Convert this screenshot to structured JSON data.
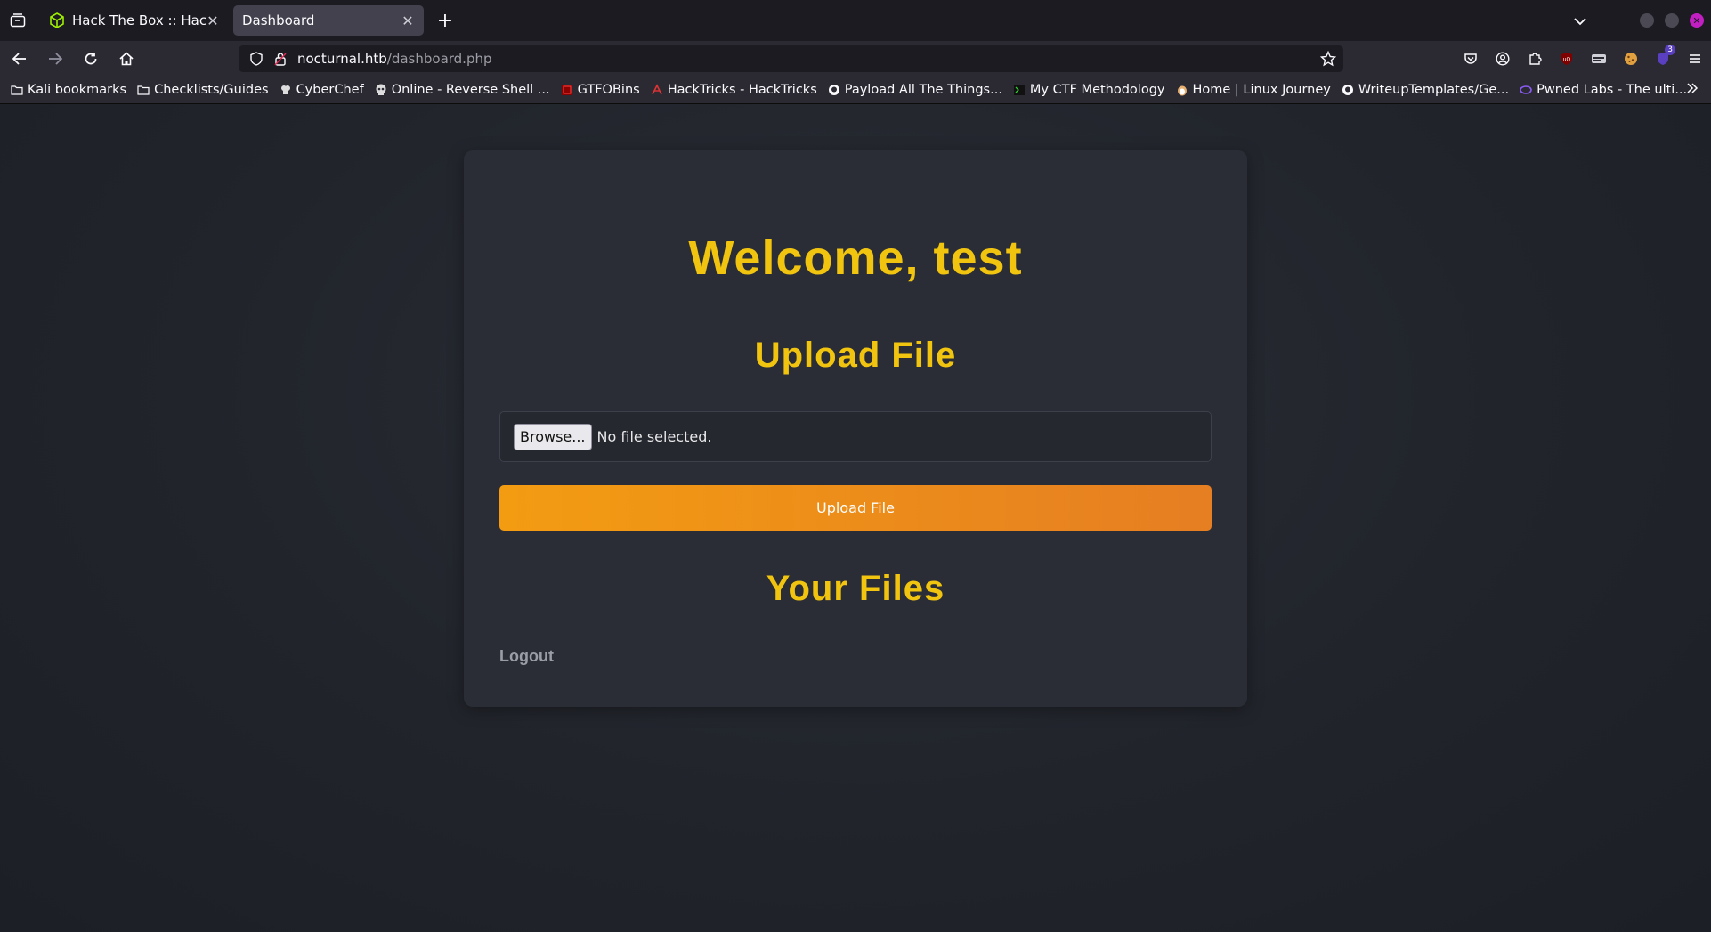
{
  "browser": {
    "tabs": [
      {
        "title": "Hack The Box :: Hack The",
        "active": false,
        "favicon": "htb-cube-icon"
      },
      {
        "title": "Dashboard",
        "active": true
      }
    ],
    "url": {
      "host": "nocturnal.htb",
      "path": "/dashboard.php"
    },
    "extension_badge": "3",
    "bookmarks": [
      {
        "label": "Kali bookmarks",
        "icon": "folder-icon"
      },
      {
        "label": "Checklists/Guides",
        "icon": "folder-icon"
      },
      {
        "label": "CyberChef",
        "icon": "chef-icon"
      },
      {
        "label": "Online - Reverse Shell ...",
        "icon": "skull-icon"
      },
      {
        "label": "GTFOBins",
        "icon": "gtfobins-icon"
      },
      {
        "label": "HackTricks - HackTricks",
        "icon": "hacktricks-icon"
      },
      {
        "label": "Payload All The Things...",
        "icon": "github-icon"
      },
      {
        "label": "My CTF Methodology",
        "icon": "terminal-icon"
      },
      {
        "label": "Home | Linux Journey",
        "icon": "penguin-icon"
      },
      {
        "label": "WriteupTemplates/Ge...",
        "icon": "github-icon"
      },
      {
        "label": "Pwned Labs - The ulti...",
        "icon": "pwnedlabs-icon"
      }
    ]
  },
  "page": {
    "welcome": "Welcome, test",
    "upload_heading": "Upload File",
    "file_input": {
      "browse_label": "Browse...",
      "status": "No file selected."
    },
    "upload_button": "Upload File",
    "files_heading": "Your Files",
    "logout": "Logout"
  },
  "colors": {
    "accent_yellow": "#f1c40f",
    "button_orange_start": "#f39c12",
    "button_orange_end": "#e67e22",
    "card_bg": "#2b2d36"
  }
}
